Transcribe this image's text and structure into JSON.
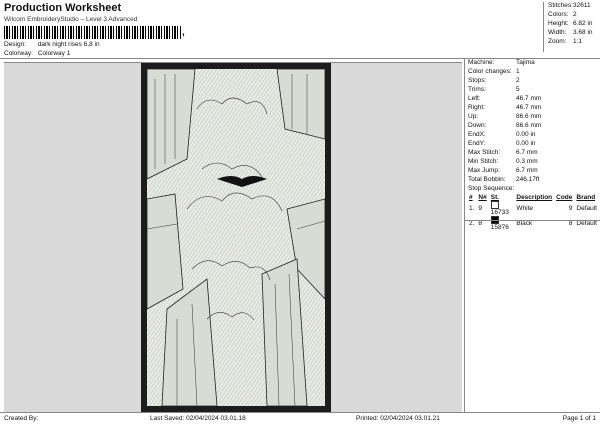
{
  "header": {
    "title": "Production Worksheet",
    "subtitle": "Wilcom EmbroideryStudio – Level 3 Advanced",
    "barcode_suffix": ","
  },
  "design_info": {
    "design_label": "Design:",
    "design_value": "dark night rises 6,8 in",
    "colorway_label": "Colorway:",
    "colorway_value": "Colorway 1"
  },
  "summary": [
    {
      "label": "Stitches:",
      "value": "32611"
    },
    {
      "label": "Colors:",
      "value": "2"
    },
    {
      "label": "Height:",
      "value": "6.82 in"
    },
    {
      "label": "Width:",
      "value": "3.68 in"
    },
    {
      "label": "Zoom:",
      "value": "1:1"
    }
  ],
  "details": [
    {
      "label": "Machine:",
      "value": "Tajima"
    },
    {
      "label": "Color changes:",
      "value": "1"
    },
    {
      "label": "Stops:",
      "value": "2"
    },
    {
      "label": "Trims:",
      "value": "5"
    },
    {
      "label": "Left:",
      "value": "46.7 mm"
    },
    {
      "label": "Right:",
      "value": "46.7 mm"
    },
    {
      "label": "Up:",
      "value": "86.6 mm"
    },
    {
      "label": "Down:",
      "value": "86.6 mm"
    },
    {
      "label": "EndX:",
      "value": "0.00 in"
    },
    {
      "label": "EndY:",
      "value": "0.00 in"
    },
    {
      "label": "Max Stitch:",
      "value": "6.7 mm"
    },
    {
      "label": "Min Stitch:",
      "value": "0.3 mm"
    },
    {
      "label": "Max Jump:",
      "value": "6.7 mm"
    },
    {
      "label": "Total Bobbin:",
      "value": "246.17ft"
    }
  ],
  "stop_sequence": {
    "label": "Stop Sequence:",
    "columns": [
      "#",
      "N#",
      "St.",
      "Description",
      "Code",
      "Brand"
    ],
    "rows": [
      {
        "num": "1.",
        "n": "9",
        "swatch": "#ffffff",
        "st": "16733",
        "desc": "White",
        "code": "9",
        "brand": "Default"
      },
      {
        "num": "2.",
        "n": "8",
        "swatch": "#000000",
        "st": "15876",
        "desc": "Black",
        "code": "8",
        "brand": "Default"
      }
    ]
  },
  "footer": {
    "created": "Created By:",
    "saved": "Last Saved: 02/04/2024 03.01.18",
    "printed": "Printed: 02/04/2024 03.01.21",
    "page": "Page 1 of 1"
  }
}
